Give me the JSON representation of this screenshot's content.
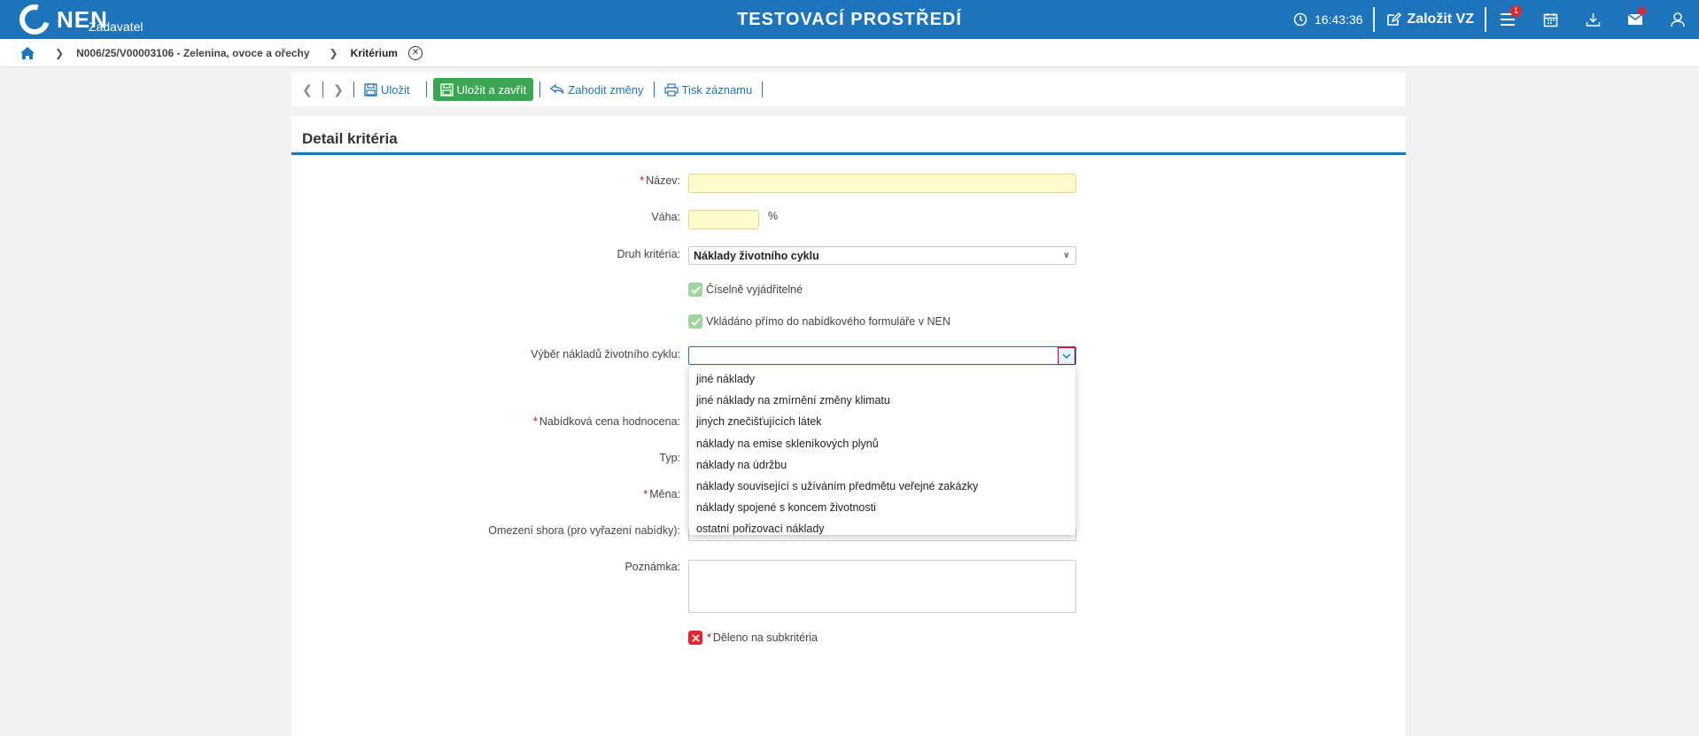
{
  "header": {
    "logo_text": "NEN",
    "logo_sub": "Zadavatel",
    "env_title": "TESTOVACÍ PROSTŘEDÍ",
    "time": "16:43:36",
    "create_label": "Založit VZ",
    "menu_badge": "1"
  },
  "breadcrumb": {
    "item1": "N006/25/V00003106 - Zelenina, ovoce a ořechy",
    "current": "Kritérium"
  },
  "toolbar": {
    "save_label": "Uložit",
    "save_close_label": "Uložit a zavřít",
    "discard_label": "Zahodit změny",
    "print_label": "Tisk záznamu"
  },
  "panel": {
    "title": "Detail kritéria"
  },
  "form": {
    "name_label": "Název:",
    "name_value": "",
    "weight_label": "Váha:",
    "weight_value": "",
    "weight_unit": "%",
    "type_label": "Druh kritéria:",
    "type_value": "Náklady životního cyklu",
    "numeric_label": "Číselně vyjádřitelné",
    "direct_label": "Vkládáno přímo do nabídkového formuláře v NEN",
    "lifecycle_label": "Výběr nákladů životního cyklu:",
    "lifecycle_value": "",
    "price_label": "Nabídková cena hodnocena:",
    "kind_label": "Typ:",
    "currency_label": "Měna:",
    "limit_label": "Omezení shora (pro vyřazení nabídky):",
    "note_label": "Poznámka:",
    "note_value": "",
    "subcriteria_label": "Děleno na subkritéria"
  },
  "dropdown": {
    "options": [
      "jiné náklady",
      "jiné náklady na zmírnění změny klimatu",
      "jiných znečišťujících látek",
      "náklady na emise skleníkových plynů",
      "náklady na údržbu",
      "náklady související s užíváním předmětu veřejné zakázky",
      "náklady spojené s koncem životnosti",
      "ostatní pořizovací náklady"
    ]
  },
  "colors": {
    "brand": "#1e74ba",
    "primary_button": "#3aa651",
    "required": "#d0021b",
    "input_required_bg": "#fff9cc"
  }
}
